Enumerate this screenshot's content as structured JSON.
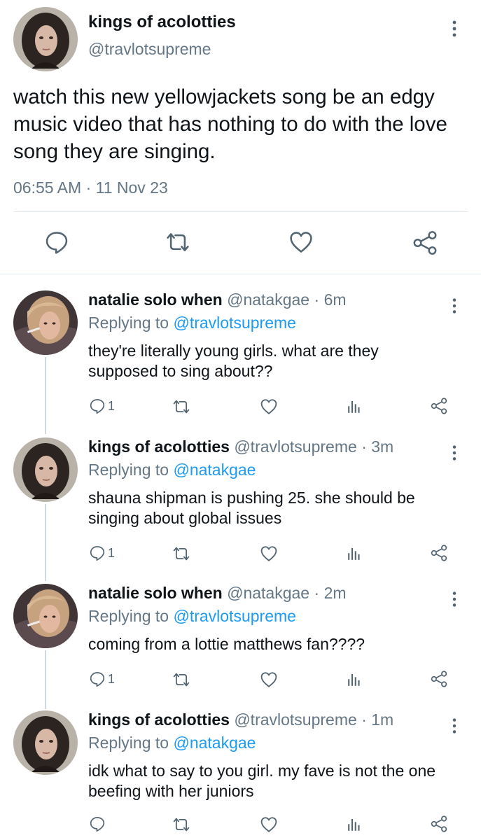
{
  "main_tweet": {
    "author_name": "kings of acolotties",
    "author_handle": "@travlotsupreme",
    "text": "watch this new yellowjackets song be an edgy music video that has nothing to do with the love song they are singing.",
    "time": "06:55 AM",
    "separator": "·",
    "date": "11 Nov 23",
    "actions": [
      "reply-icon",
      "retweet-icon",
      "like-icon",
      "share-icon"
    ]
  },
  "replies": [
    {
      "name": "natalie solo when",
      "handle": "@natakgae",
      "sep": "·",
      "time": "6m",
      "replying_label": "Replying to",
      "replying_to": "@travlotsupreme",
      "text": "they're literally young girls. what are they supposed to sing about??",
      "reply_count": "1"
    },
    {
      "name": "kings of acolotties",
      "handle": "@travlotsupreme",
      "sep": "·",
      "time": "3m",
      "replying_label": "Replying to",
      "replying_to": "@natakgae",
      "text": "shauna shipman is pushing 25. she should be singing about global issues",
      "reply_count": "1"
    },
    {
      "name": "natalie solo when",
      "handle": "@natakgae",
      "sep": "·",
      "time": "2m",
      "replying_label": "Replying to",
      "replying_to": "@travlotsupreme",
      "text": "coming from a lottie matthews fan????",
      "reply_count": "1"
    },
    {
      "name": "kings of acolotties",
      "handle": "@travlotsupreme",
      "sep": "·",
      "time": "1m",
      "replying_label": "Replying to",
      "replying_to": "@natakgae",
      "text": "idk what to say to you girl. my fave is not the one beefing with her juniors",
      "reply_count": ""
    }
  ],
  "colors": {
    "text": "#0f1419",
    "secondary": "#657786",
    "link": "#1d9bf0",
    "divider": "#e1e8ed",
    "thread_line": "#cfd9de"
  }
}
